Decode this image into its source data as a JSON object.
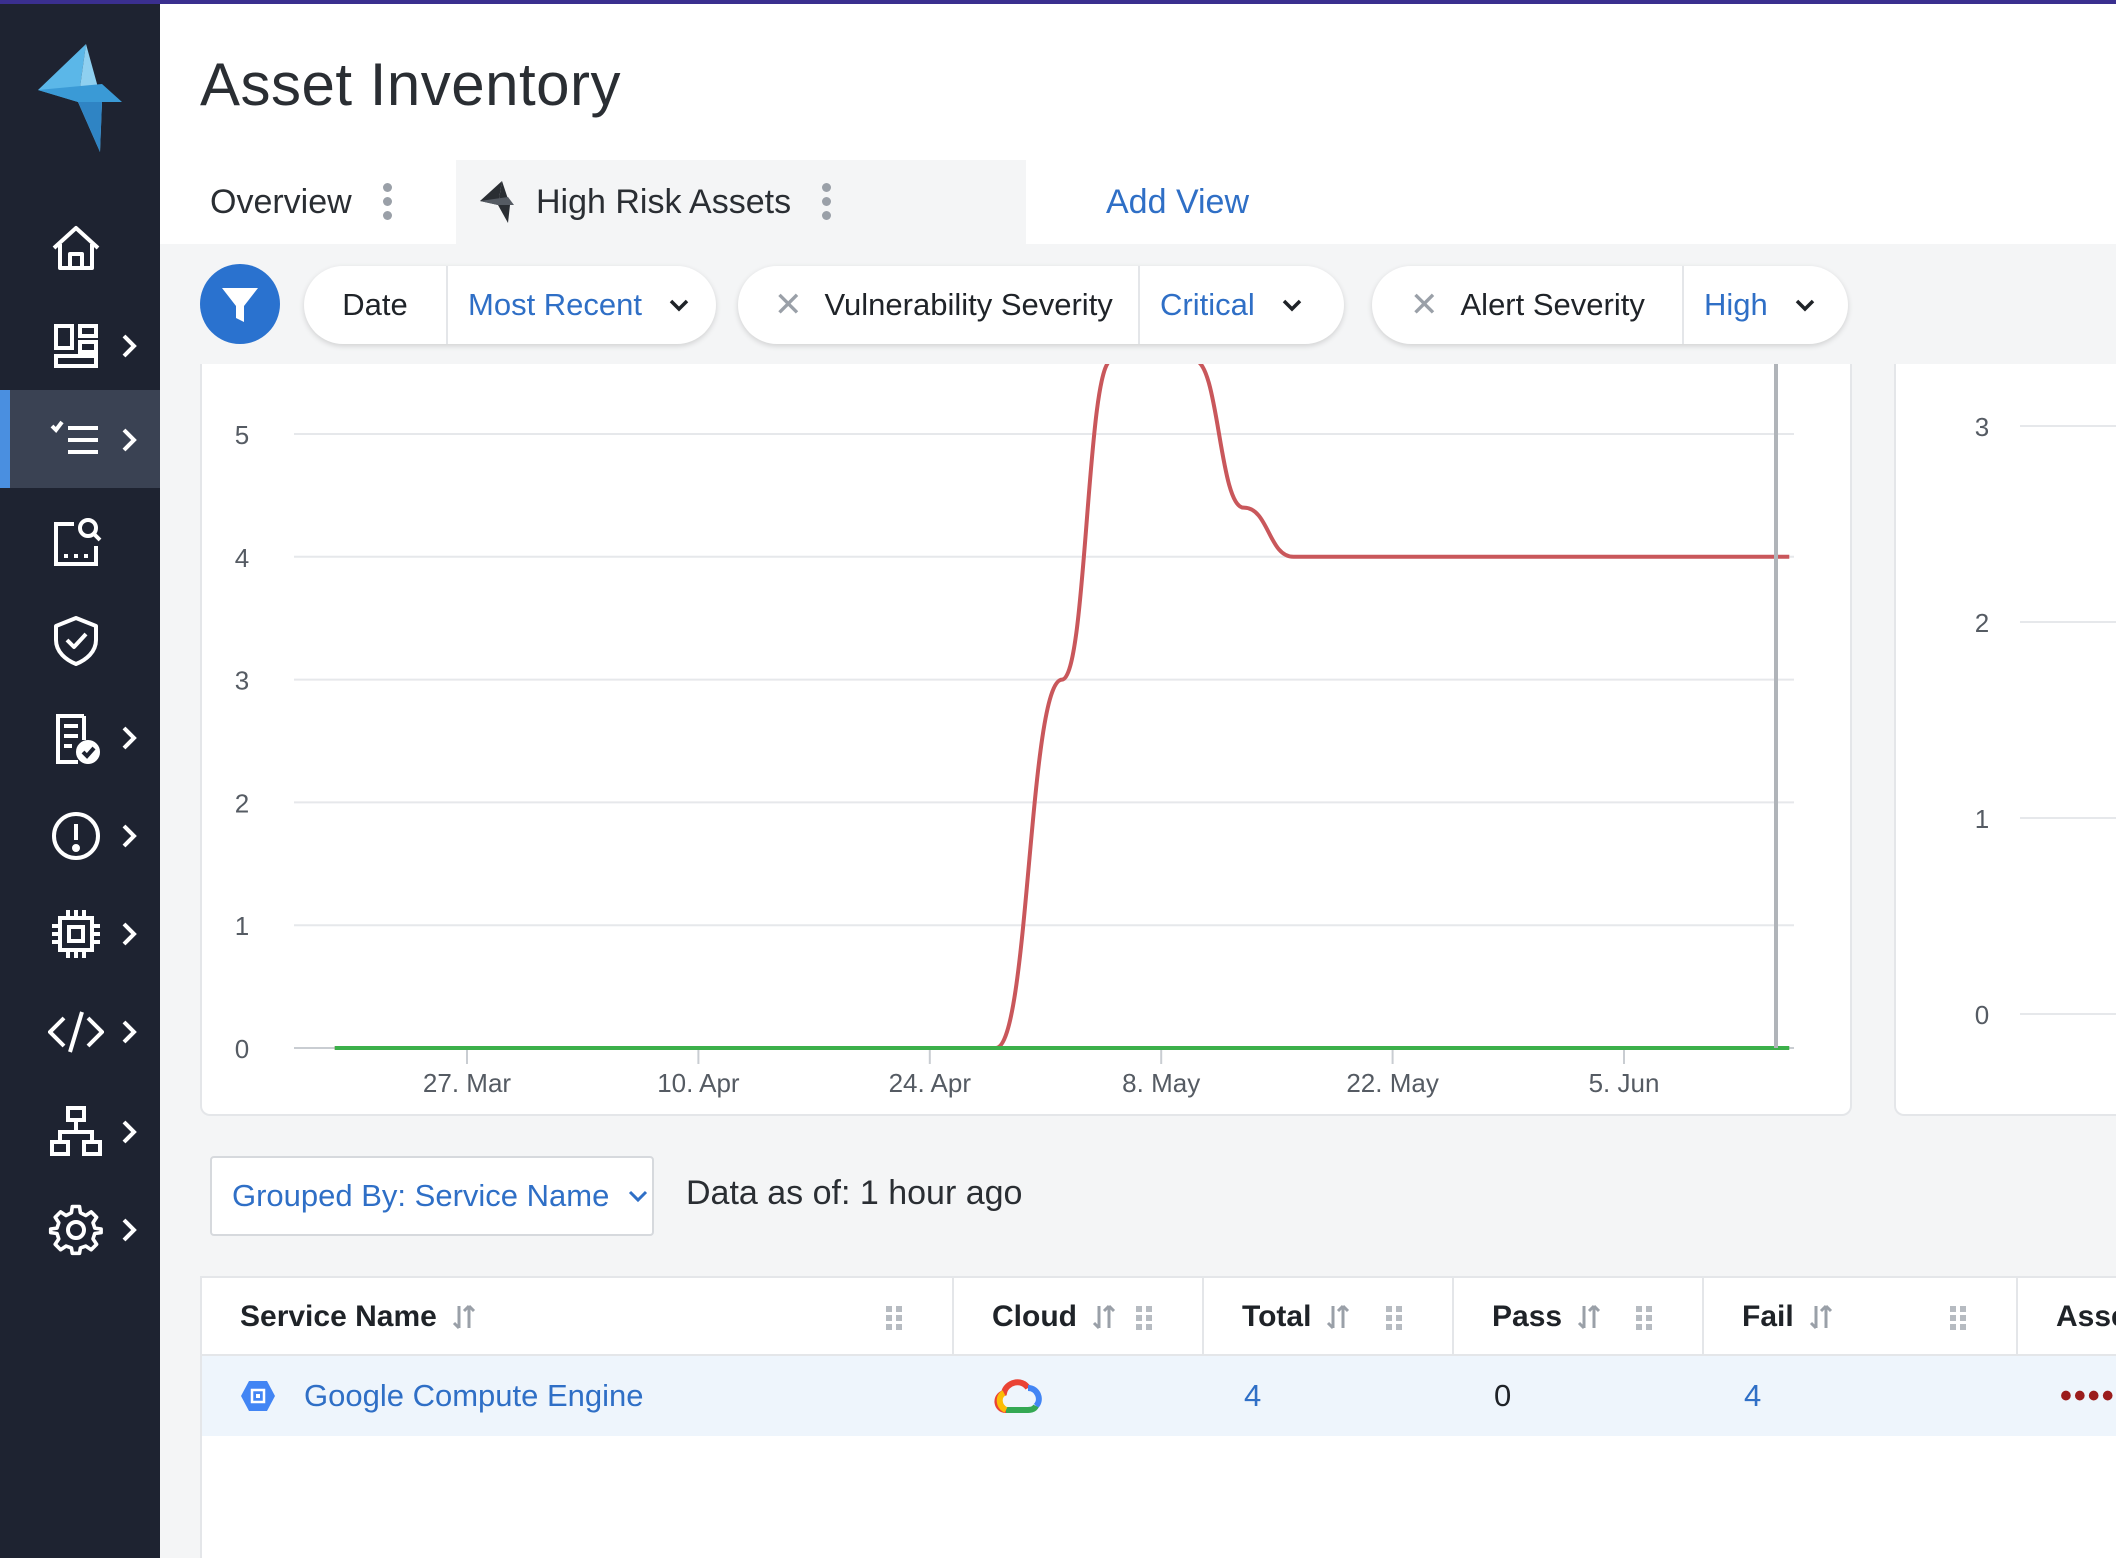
{
  "page": {
    "title": "Asset Inventory"
  },
  "colors": {
    "sidebar": "#1e2331",
    "accent": "#2f6fc6",
    "critical_line": "#c9575b",
    "baseline_line": "#3cb04a",
    "row_highlight": "#eef5fc"
  },
  "sidebar": {
    "items": [
      {
        "icon": "home-icon",
        "has_submenu": false
      },
      {
        "icon": "dashboard-icon",
        "has_submenu": true
      },
      {
        "icon": "inventory-list-icon",
        "has_submenu": true,
        "active": true
      },
      {
        "icon": "search-document-icon",
        "has_submenu": false
      },
      {
        "icon": "shield-check-icon",
        "has_submenu": false
      },
      {
        "icon": "compliance-report-icon",
        "has_submenu": true
      },
      {
        "icon": "alert-icon",
        "has_submenu": true
      },
      {
        "icon": "chip-icon",
        "has_submenu": true
      },
      {
        "icon": "code-icon",
        "has_submenu": true
      },
      {
        "icon": "network-icon",
        "has_submenu": true
      },
      {
        "icon": "settings-icon",
        "has_submenu": true
      }
    ]
  },
  "tabs": {
    "overview": "Overview",
    "high_risk": "High Risk Assets",
    "add_view": "Add View"
  },
  "filters": {
    "date": {
      "label": "Date",
      "value": "Most Recent"
    },
    "vuln": {
      "label": "Vulnerability Severity",
      "value": "Critical",
      "remove": "✕"
    },
    "alert": {
      "label": "Alert Severity",
      "value": "High",
      "remove": "✕"
    }
  },
  "chart_data": [
    {
      "type": "line",
      "title": "",
      "xlabel": "",
      "ylabel": "",
      "ylim": [
        0,
        5
      ],
      "yticks": [
        "0",
        "1",
        "2",
        "3",
        "4",
        "5"
      ],
      "xticks": [
        "27. Mar",
        "10. Apr",
        "24. Apr",
        "8. May",
        "22. May",
        "5. Jun"
      ],
      "grid": true,
      "series": [
        {
          "color": "#c9575b",
          "points": [
            {
              "x": "2024-03-19",
              "y": 0
            },
            {
              "x": "2024-04-28",
              "y": 0
            },
            {
              "x": "2024-05-02",
              "y": 3
            },
            {
              "x": "2024-05-05",
              "y": 5.6
            },
            {
              "x": "2024-05-10",
              "y": 5.6
            },
            {
              "x": "2024-05-13",
              "y": 4.4
            },
            {
              "x": "2024-05-16",
              "y": 4
            },
            {
              "x": "2024-06-15",
              "y": 4
            }
          ]
        },
        {
          "color": "#3cb04a",
          "points": [
            {
              "x": "2024-03-19",
              "y": 0
            },
            {
              "x": "2024-06-15",
              "y": 0
            }
          ]
        }
      ]
    },
    {
      "type": "line",
      "title": "",
      "ylim": [
        0,
        3
      ],
      "yticks": [
        "0",
        "1",
        "2",
        "3"
      ],
      "grid": true,
      "series": []
    }
  ],
  "grouping": {
    "label": "Grouped By: Service Name",
    "data_as_of": "Data as of: 1 hour ago"
  },
  "table": {
    "columns": {
      "service": "Service Name",
      "cloud": "Cloud",
      "total": "Total",
      "pass": "Pass",
      "fail": "Fail",
      "asset": "Asse"
    },
    "rows": [
      {
        "service": "Google Compute Engine",
        "cloud_icon": "google-cloud-icon",
        "total": "4",
        "pass": "0",
        "fail": "4",
        "asset_indicator": "••••"
      }
    ]
  }
}
